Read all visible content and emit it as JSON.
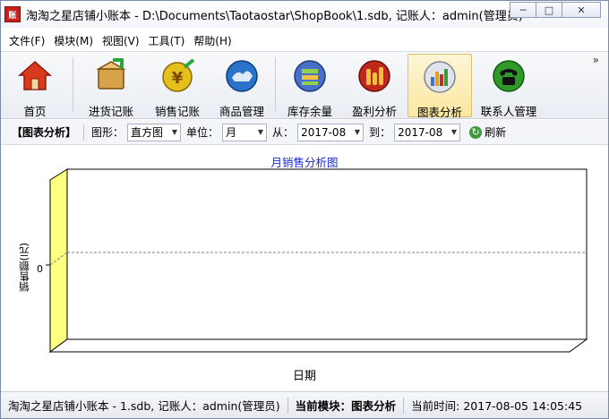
{
  "window": {
    "title": "淘淘之星店铺小账本 - D:\\Documents\\Taotaostar\\ShopBook\\1.sdb, 记账人：admin(管理员)",
    "icon_text": "账",
    "controls": {
      "minimize": "─",
      "maximize": "□",
      "close": "✕"
    }
  },
  "menu": {
    "items": [
      "文件(F)",
      "模块(M)",
      "视图(V)",
      "工具(T)",
      "帮助(H)"
    ]
  },
  "toolbar": {
    "overflow": "»",
    "buttons": [
      {
        "label": "首页",
        "icon": "home-icon",
        "color": "#d93a1c"
      },
      {
        "label": "进货记账",
        "icon": "purchase-icon",
        "color": "#d8a24a"
      },
      {
        "label": "销售记账",
        "icon": "sales-icon",
        "color": "#e3c01c"
      },
      {
        "label": "商品管理",
        "icon": "product-icon",
        "color": "#2a73c8"
      },
      {
        "label": "库存余量",
        "icon": "inventory-icon",
        "color": "#4a6fc8"
      },
      {
        "label": "盈利分析",
        "icon": "profit-icon",
        "color": "#c0281c"
      },
      {
        "label": "图表分析",
        "icon": "chart-icon",
        "color": "#b6bcc8",
        "active": true
      },
      {
        "label": "联系人管理",
        "icon": "contact-icon",
        "color": "#2f9a2a"
      }
    ]
  },
  "chartbar": {
    "section": "【图表分析】",
    "shape_label": "图形：",
    "shape_value": "直方图",
    "unit_label": "单位：",
    "unit_value": "月",
    "from_label": "从：",
    "from_value": "2017-08",
    "to_label": "到：",
    "to_value": "2017-08",
    "refresh_label": "刷新"
  },
  "chart_data": {
    "type": "bar",
    "title": "月销售分析图",
    "xlabel": "日期",
    "ylabel": "销售额(元)",
    "categories": [],
    "values": [],
    "y_ticks": [
      "0"
    ],
    "colors": {
      "wall": "#ffff80",
      "title": "#1a2ad0"
    }
  },
  "statusbar": {
    "file_info": "淘淘之星店铺小账本 - 1.sdb, 记账人：admin(管理员)",
    "module_label": "当前模块：",
    "module_value": "图表分析",
    "time_label": "当前时间: ",
    "time_value": "2017-08-05 14:05:45"
  }
}
